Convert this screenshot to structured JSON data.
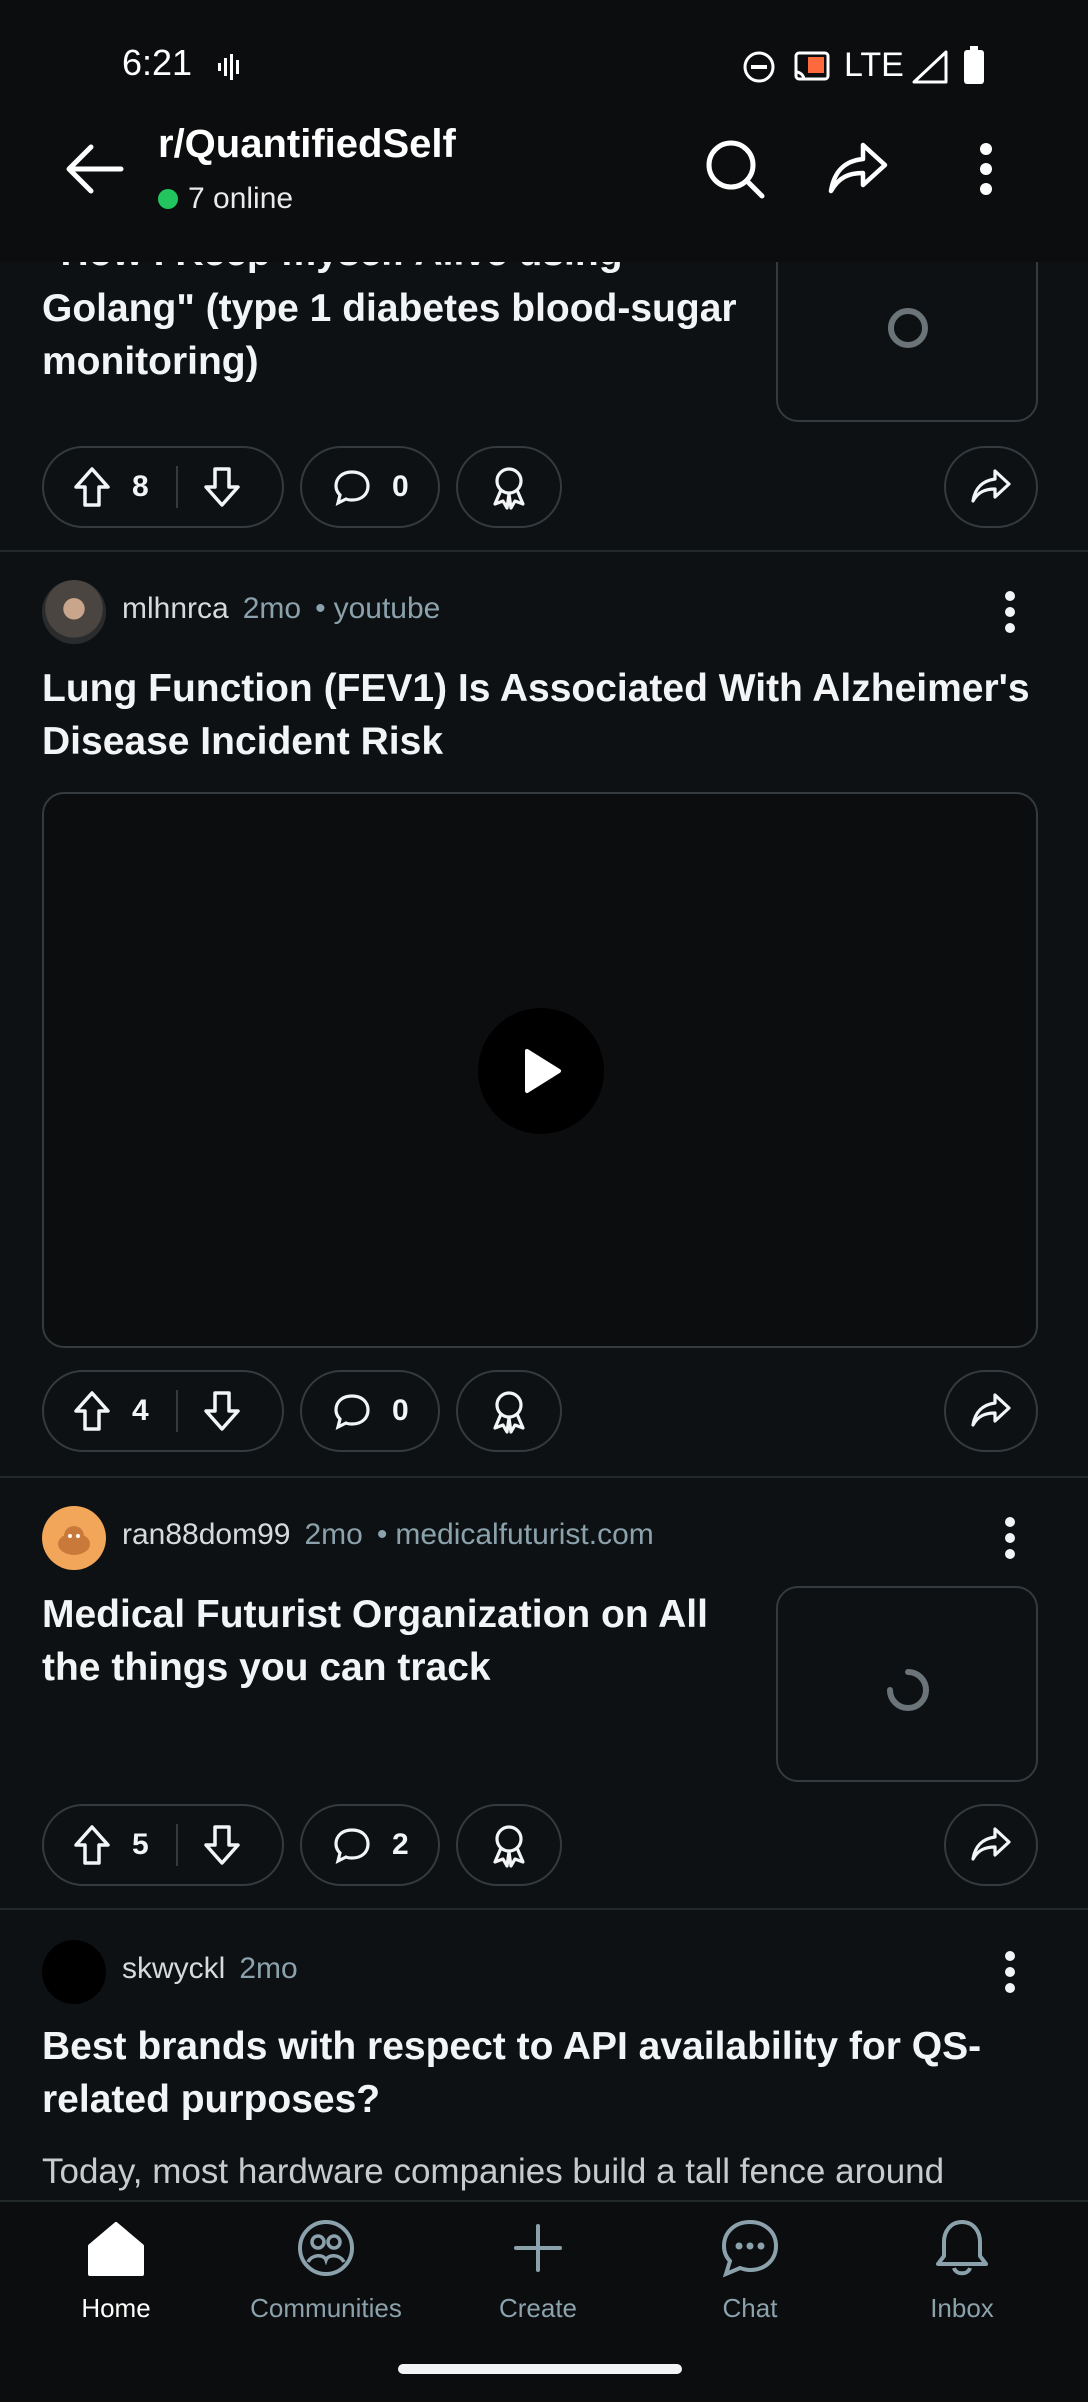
{
  "status": {
    "time": "6:21",
    "network": "LTE"
  },
  "header": {
    "subreddit": "r/QuantifiedSelf",
    "online": "7 online"
  },
  "posts": [
    {
      "title_fragment": "\"How I Keep myself Alive using",
      "title": "Golang\" (type 1 diabetes blood-sugar monitoring)",
      "upvotes": "8",
      "comments": "0"
    },
    {
      "user": "mlhnrca",
      "age": "2mo",
      "source": "youtube",
      "title": "Lung Function (FEV1) Is Associated With Alzheimer's Disease Incident Risk",
      "upvotes": "4",
      "comments": "0"
    },
    {
      "user": "ran88dom99",
      "age": "2mo",
      "source": "medicalfuturist.com",
      "title": "Medical Futurist Organization on All the things you can track",
      "upvotes": "5",
      "comments": "2"
    },
    {
      "user": "skwyckl",
      "age": "2mo",
      "title": "Best brands with respect to API availability for QS-related purposes?",
      "preview": "Today, most hardware companies build a tall fence around"
    }
  ],
  "nav": [
    {
      "label": "Home",
      "icon": "home-icon"
    },
    {
      "label": "Communities",
      "icon": "communities-icon"
    },
    {
      "label": "Create",
      "icon": "plus-icon"
    },
    {
      "label": "Chat",
      "icon": "chat-icon"
    },
    {
      "label": "Inbox",
      "icon": "bell-icon"
    }
  ],
  "colors": {
    "background": "#0e1113",
    "online_dot": "#22c55e",
    "border": "#343a3d"
  }
}
